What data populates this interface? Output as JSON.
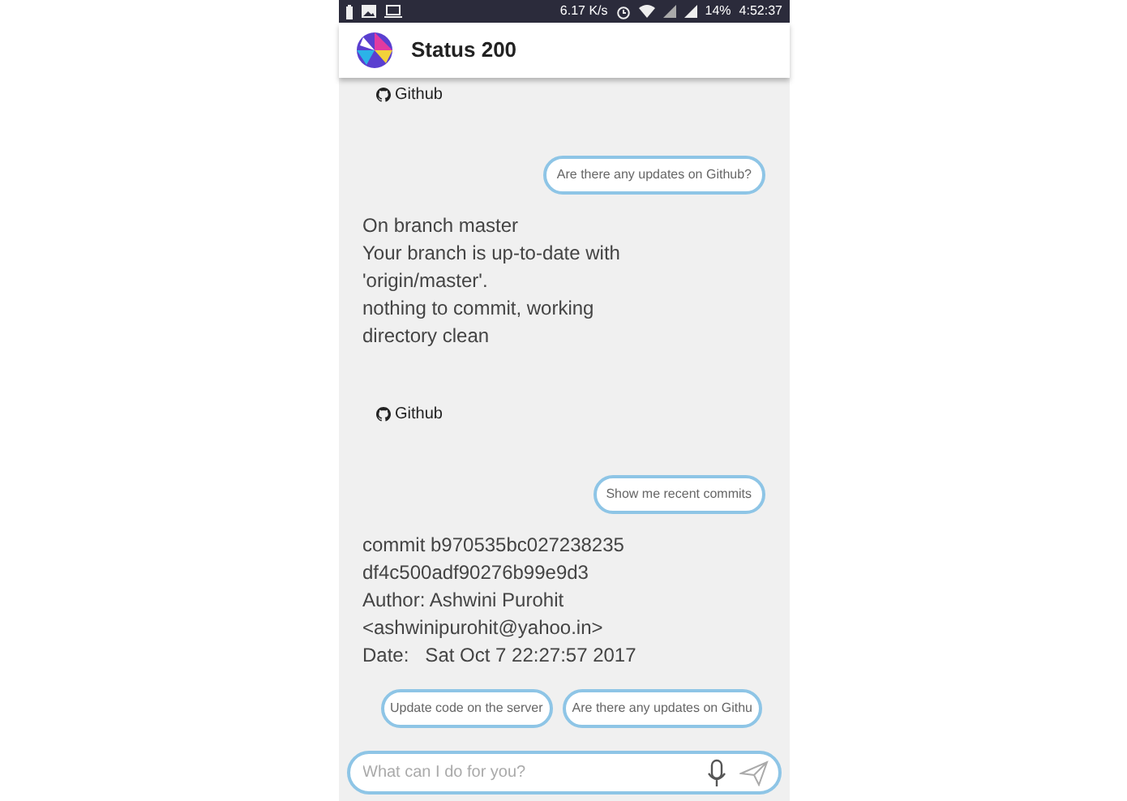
{
  "status_bar": {
    "speed": "6.17 K/s",
    "battery": "14%",
    "time": "4:52:37"
  },
  "app_bar": {
    "title": "Status 200"
  },
  "messages": [
    {
      "kind": "source",
      "text": "Github"
    },
    {
      "kind": "user",
      "text": "Are there any updates on Github?"
    },
    {
      "kind": "bot",
      "text": "On branch master\nYour branch is up-to-date with\n'origin/master'.\nnothing to commit, working\ndirectory clean"
    },
    {
      "kind": "source",
      "text": "Github"
    },
    {
      "kind": "user",
      "text": "Show me recent commits"
    },
    {
      "kind": "bot",
      "text": "commit b970535bc027238235\ndf4c500adf90276b99e9d3\nAuthor: Ashwini Purohit\n<ashwinipurohit@yahoo.in>\nDate:   Sat Oct 7 22:27:57 2017"
    }
  ],
  "suggestions": [
    "Update code on the server",
    "Are there any updates on Githu"
  ],
  "input": {
    "placeholder": "What can I do for you?"
  }
}
